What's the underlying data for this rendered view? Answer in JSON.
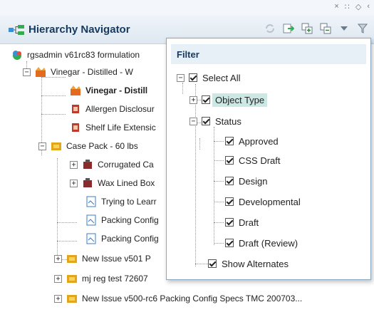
{
  "window_controls": [
    "×",
    "∷",
    "◇",
    "‹"
  ],
  "header": {
    "title": "Hierarchy Navigator"
  },
  "tree": {
    "root": "rgsadmin v61rc83 formulation",
    "items": [
      {
        "label": "Vinegar - Distilled - W",
        "bold": false
      },
      {
        "label": "Vinegar - Distill",
        "bold": true
      },
      {
        "label": "Allergen Disclosur",
        "bold": false
      },
      {
        "label": "Shelf Life Extensic",
        "bold": false
      },
      {
        "label": "Case Pack - 60 lbs",
        "bold": false
      },
      {
        "label": "Corrugated Ca",
        "bold": false
      },
      {
        "label": "Wax Lined Box",
        "bold": false
      },
      {
        "label": "Trying to Learr",
        "bold": false
      },
      {
        "label": "Packing Config",
        "bold": false
      },
      {
        "label": "Packing Config",
        "bold": false
      },
      {
        "label": "New Issue v501 P",
        "bold": false
      },
      {
        "label": "mj reg test 72607",
        "bold": false
      },
      {
        "label": "New Issue v500-rc6 Packing Config Specs TMC 200703...",
        "bold": false
      }
    ]
  },
  "filter": {
    "title": "Filter",
    "select_all": "Select All",
    "object_type": "Object Type",
    "status": "Status",
    "statuses": [
      "Approved",
      "CSS Draft",
      "Design",
      "Developmental",
      "Draft",
      "Draft (Review)"
    ],
    "show_alternates": "Show Alternates"
  },
  "colors": {
    "accent": "#163a5f",
    "highlight": "#cce8e4",
    "header_bg": "#dfe8f1"
  }
}
